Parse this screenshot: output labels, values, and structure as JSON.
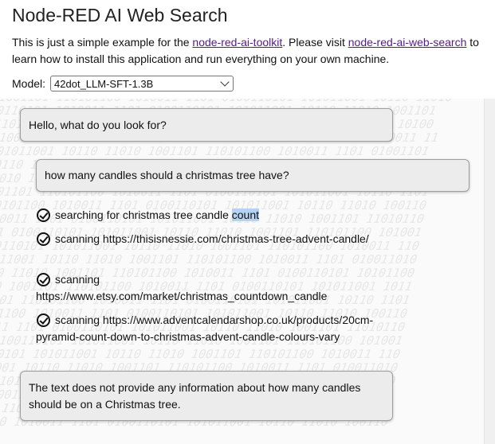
{
  "header": {
    "title": "Node-RED AI Web Search"
  },
  "intro": {
    "text_1": "This is just a simple example for the ",
    "link_toolkit": "node-red-ai-toolkit",
    "text_2": ". Please visit ",
    "link_web_search": "node-red-ai-web-search",
    "text_3": " to learn how to install this application and run everything on your own machine."
  },
  "model": {
    "label": "Model:",
    "selected": "42dot_LLM-SFT-1.3B"
  },
  "chat": {
    "greeting": "Hello, what do you look for?",
    "user_query": "how many candles should a christmas tree have?",
    "steps": [
      {
        "text": "searching for christmas tree candle ",
        "highlight": "count"
      },
      {
        "text": "scanning https://thisisnessie.com/christmas-tree-advent-candle/"
      },
      {
        "text": "scanning https://www.etsy.com/market/christmas_countdown_candle"
      },
      {
        "text": "scanning https://www.adventcalendarshop.co.uk/products/20cm-pyramid-count-down-to-christmas-advent-candle-colours-vary"
      }
    ],
    "answer": "The text does not provide any information about how many candles should be on a Christmas tree."
  },
  "colors": {
    "link": "#551a8b",
    "bubble_bg": "#ececec",
    "selection": "#b4d2f3"
  },
  "icons": {
    "step_status": "check-circle-icon",
    "select_toggle": "chevron-down-icon"
  }
}
